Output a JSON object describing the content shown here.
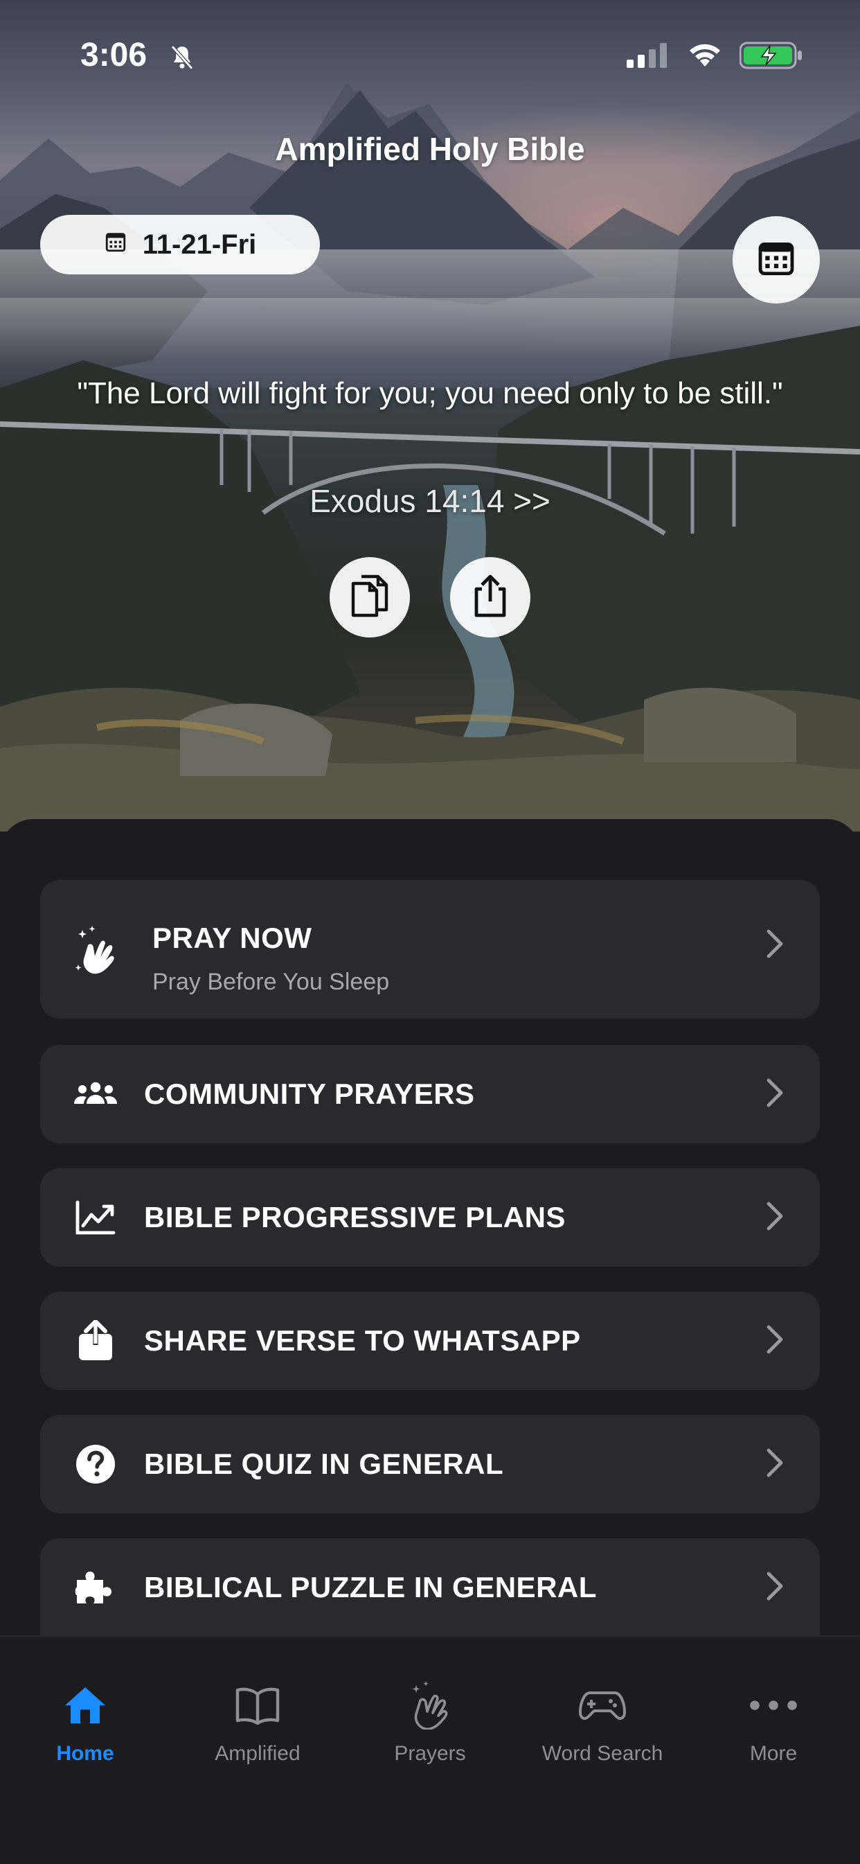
{
  "status_bar": {
    "time": "3:06"
  },
  "header": {
    "title": "Amplified Holy Bible"
  },
  "date_pill": {
    "label": "11-21-Fri"
  },
  "verse": {
    "text": "\"The Lord will fight for you; you need only to be still.\"",
    "reference": "Exodus 14:14 >>"
  },
  "menu": {
    "pray": {
      "title": "PRAY NOW",
      "subtitle": "Pray Before You Sleep"
    },
    "items": [
      {
        "label": "COMMUNITY PRAYERS",
        "icon": "people-group-icon"
      },
      {
        "label": "BIBLE PROGRESSIVE PLANS",
        "icon": "chart-line-icon"
      },
      {
        "label": "SHARE VERSE TO WHATSAPP",
        "icon": "share-icon"
      },
      {
        "label": "BIBLE QUIZ IN GENERAL",
        "icon": "question-circle-icon"
      },
      {
        "label": "BIBLICAL PUZZLE IN GENERAL",
        "icon": "puzzle-icon"
      }
    ]
  },
  "tabs": [
    {
      "label": "Home",
      "icon": "home-icon",
      "active": true
    },
    {
      "label": "Amplified",
      "icon": "book-icon"
    },
    {
      "label": "Prayers",
      "icon": "praying-hands-icon"
    },
    {
      "label": "Word Search",
      "icon": "gamepad-icon"
    },
    {
      "label": "More",
      "icon": "more-dots-icon"
    }
  ],
  "colors": {
    "accent": "#1a8cff",
    "card": "#2a2a2c",
    "background": "#1c1c1e",
    "battery": "#34c759"
  }
}
